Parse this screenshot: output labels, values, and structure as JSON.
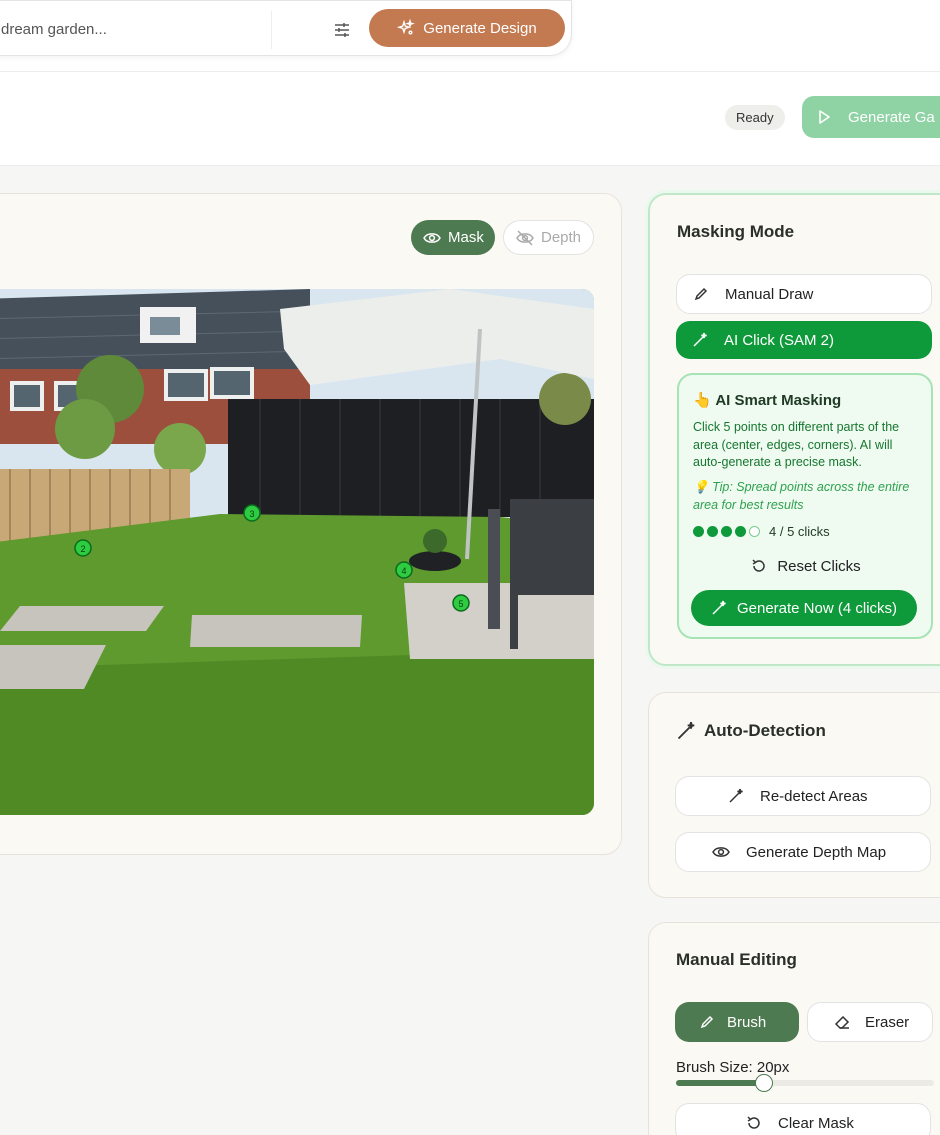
{
  "search": {
    "placeholder": "dream garden...",
    "generate_label": "Generate Design"
  },
  "status": {
    "badge": "Ready",
    "generate_garden_label": "Generate Ga"
  },
  "canvas": {
    "mask_label": "Mask",
    "depth_label": "Depth",
    "click_points": [
      "2",
      "3",
      "4",
      "5"
    ]
  },
  "masking_mode": {
    "title": "Masking Mode",
    "manual_draw_label": "Manual Draw",
    "ai_click_label": "AI Click (SAM 2)",
    "smart": {
      "title": "AI Smart Masking",
      "description": "Click 5 points on different parts of the area (center, edges, corners). AI will auto-generate a precise mask.",
      "tip": "Tip: Spread points across the entire area for best results",
      "clicks_done": 4,
      "clicks_total": 5,
      "clicks_text": "4 / 5 clicks",
      "reset_label": "Reset Clicks",
      "generate_now_label": "Generate Now (4 clicks)"
    }
  },
  "auto_detection": {
    "title": "Auto-Detection",
    "redetect_label": "Re-detect Areas",
    "depth_map_label": "Generate Depth Map"
  },
  "manual_editing": {
    "title": "Manual Editing",
    "brush_label": "Brush",
    "eraser_label": "Eraser",
    "brush_size_label": "Brush Size: 20px",
    "brush_size_fraction": 0.34,
    "clear_mask_label": "Clear Mask"
  },
  "colors": {
    "accent_orange": "#c47a50",
    "primary_green": "#0e9a3a",
    "dark_green": "#4d7a51",
    "light_green": "#8fd3a4"
  }
}
